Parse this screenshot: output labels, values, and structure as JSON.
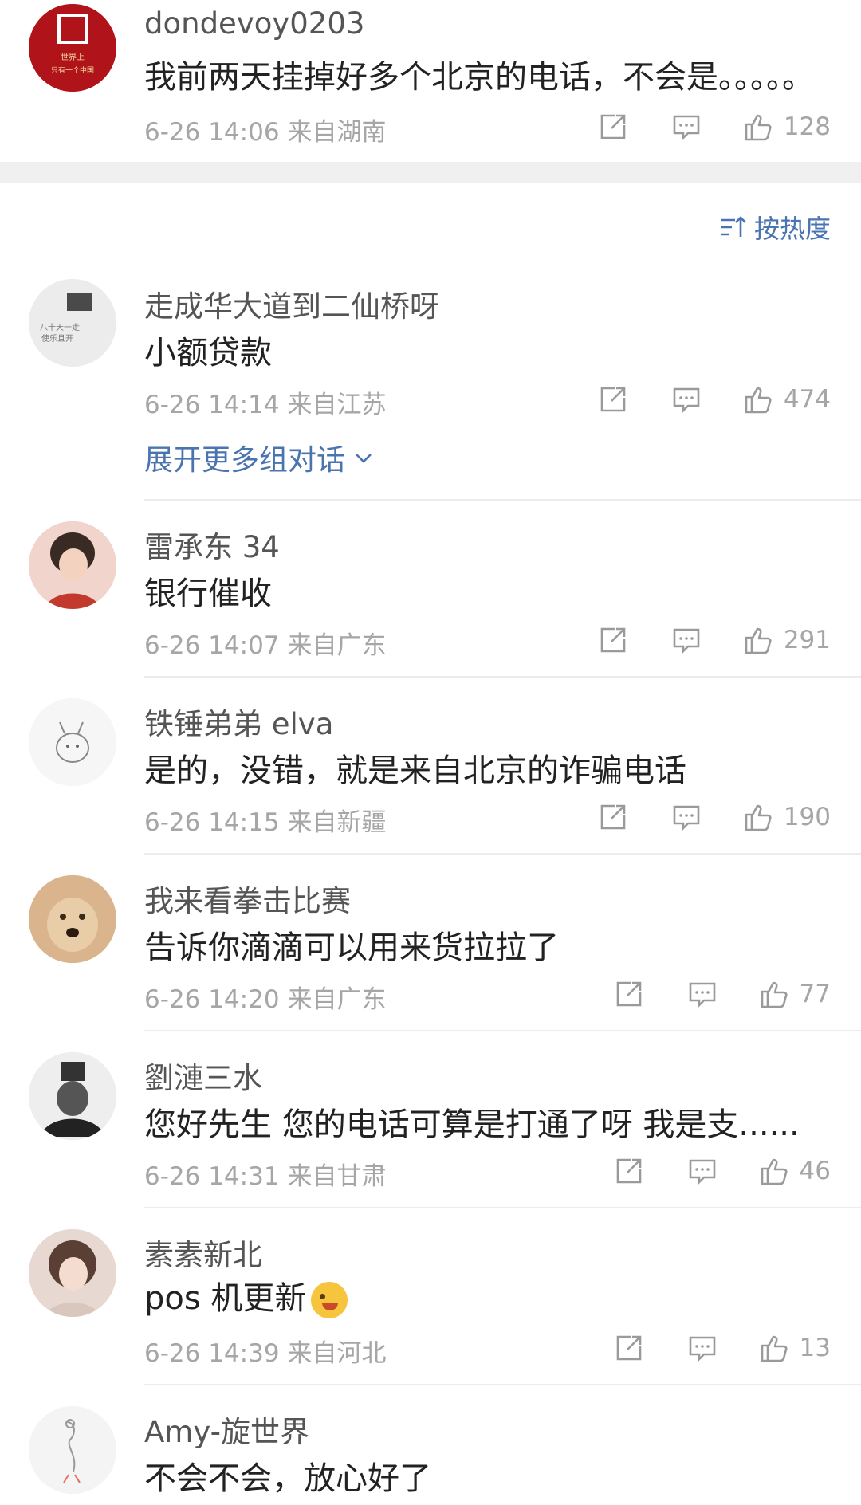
{
  "sort": {
    "label": "按热度"
  },
  "expand": {
    "label": "展开更多组对话"
  },
  "comments": [
    {
      "user": "dondevoy0203",
      "text": "我前两天挂掉好多个北京的电话，不会是。。。。。",
      "time": "6-26 14:06",
      "loc": "来自湖南",
      "likes": "128",
      "avatar_color": "#b0141a"
    },
    {
      "user": "走成华大道到二仙桥呀",
      "text": "小额贷款",
      "time": "6-26 14:14",
      "loc": "来自江苏",
      "likes": "474",
      "avatar_color": "#e5e5e5"
    },
    {
      "user": "雷承东 34",
      "text": "银行催收",
      "time": "6-26 14:07",
      "loc": "来自广东",
      "likes": "291",
      "avatar_color": "#e8b8a8"
    },
    {
      "user": "铁锤弟弟 elva",
      "text": "是的，没错，就是来自北京的诈骗电话",
      "time": "6-26 14:15",
      "loc": "来自新疆",
      "likes": "190",
      "avatar_color": "#f4f4f4"
    },
    {
      "user": "我来看拳击比赛",
      "text": "告诉你滴滴可以用来货拉拉了",
      "time": "6-26 14:20",
      "loc": "来自广东",
      "likes": "77",
      "avatar_color": "#c9a27a"
    },
    {
      "user": "劉漣三水",
      "text": "您好先生 您的电话可算是打通了呀 我是支......",
      "time": "6-26 14:31",
      "loc": "来自甘肃",
      "likes": "46",
      "avatar_color": "#d8d8d8"
    },
    {
      "user": "素素新北",
      "text": "pos 机更新",
      "time": "6-26 14:39",
      "loc": "来自河北",
      "likes": "13",
      "avatar_color": "#e2cfc8"
    },
    {
      "user": "Amy-旋世界",
      "text": "不会不会，放心好了",
      "time": "",
      "loc": "",
      "likes": "",
      "avatar_color": "#f2f2f2"
    }
  ],
  "icons": {
    "share": "share-icon",
    "reply": "comment-icon",
    "like": "thumbs-up-icon",
    "sort": "sort-icon",
    "expand": "chevron-down-icon"
  },
  "colors": {
    "link": "#4a74b0",
    "meta": "#a6a6a6"
  }
}
